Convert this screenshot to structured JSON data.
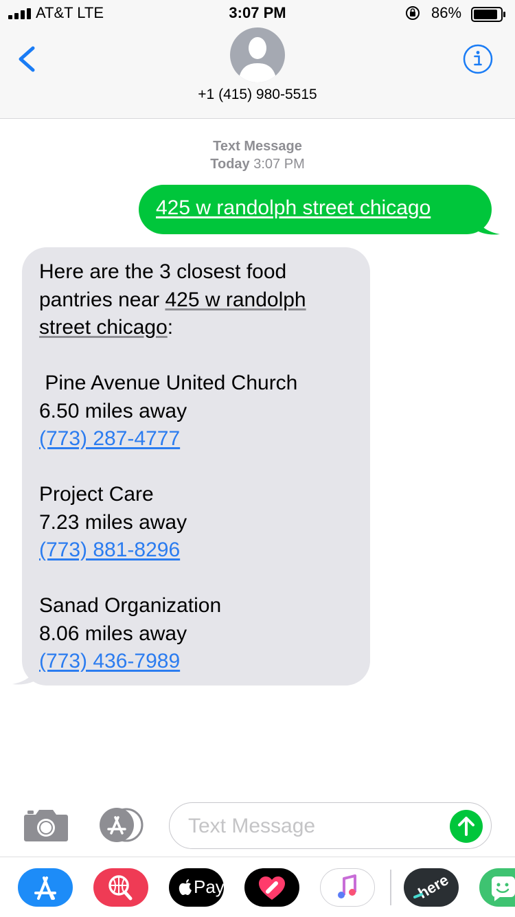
{
  "status_bar": {
    "carrier": "AT&T  LTE",
    "time": "3:07 PM",
    "battery": "86%"
  },
  "header": {
    "contact": "+1 (415) 980-5515"
  },
  "thread": {
    "timestamp_label": "Text Message",
    "timestamp_day": "Today",
    "timestamp_time": "3:07 PM",
    "outgoing": "425 w randolph street chicago",
    "incoming": {
      "intro_prefix": "Here are the 3 closest food pantries near ",
      "intro_address": "425 w randolph street chicago",
      "intro_suffix": ":",
      "results": [
        {
          "name": " Pine Avenue United Church",
          "distance": "6.50 miles away",
          "phone": "(773) 287-4777"
        },
        {
          "name": "Project Care",
          "distance": "7.23 miles away",
          "phone": "(773) 881-8296"
        },
        {
          "name": "Sanad Organization",
          "distance": "8.06 miles away",
          "phone": "(773) 436-7989"
        }
      ]
    }
  },
  "composer": {
    "placeholder": "Text Message"
  },
  "drawer": {
    "apple_pay_label": "Pay",
    "here_label": "here"
  },
  "colors": {
    "sms_green": "#00c63b",
    "link_blue": "#2b7cf0",
    "ios_blue": "#1a7cf5",
    "incoming_bubble": "#e5e5ea"
  }
}
